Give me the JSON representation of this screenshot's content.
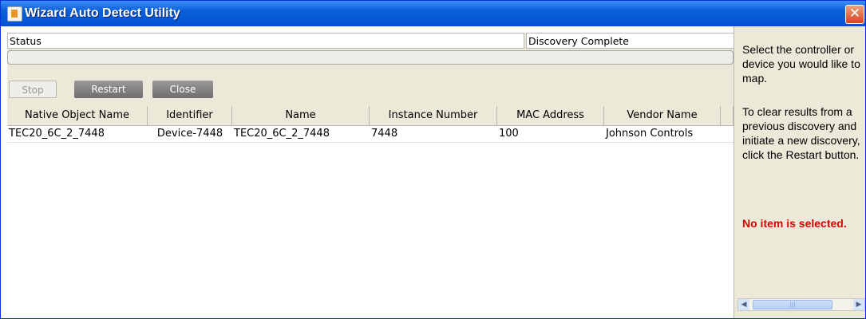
{
  "window": {
    "title": "Wizard Auto Detect Utility",
    "close_glyph": "✕"
  },
  "status": {
    "label": "Status",
    "value": "Discovery Complete"
  },
  "buttons": {
    "stop": "Stop",
    "restart": "Restart",
    "close": "Close"
  },
  "table": {
    "columns": [
      "Native Object Name",
      "Identifier",
      "Name",
      "Instance Number",
      "MAC Address",
      "Vendor Name"
    ],
    "rows": [
      [
        "TEC20_6C_2_7448",
        "Device-7448",
        "TEC20_6C_2_7448",
        "7448",
        "100",
        "Johnson Controls"
      ]
    ]
  },
  "side_panel": {
    "instructions_1": "Select the controller or device you would like to map.",
    "instructions_2": "To clear results from a previous discovery and initiate a new discovery, click the Restart button.",
    "selection_status": "No item is selected."
  },
  "colors": {
    "title_bar": "#0a5fd8",
    "selection_status": "#e00000",
    "close_button": "#d8431a"
  },
  "icons": [
    "app-icon",
    "close-icon",
    "scroll-left-icon",
    "scroll-right-icon"
  ]
}
